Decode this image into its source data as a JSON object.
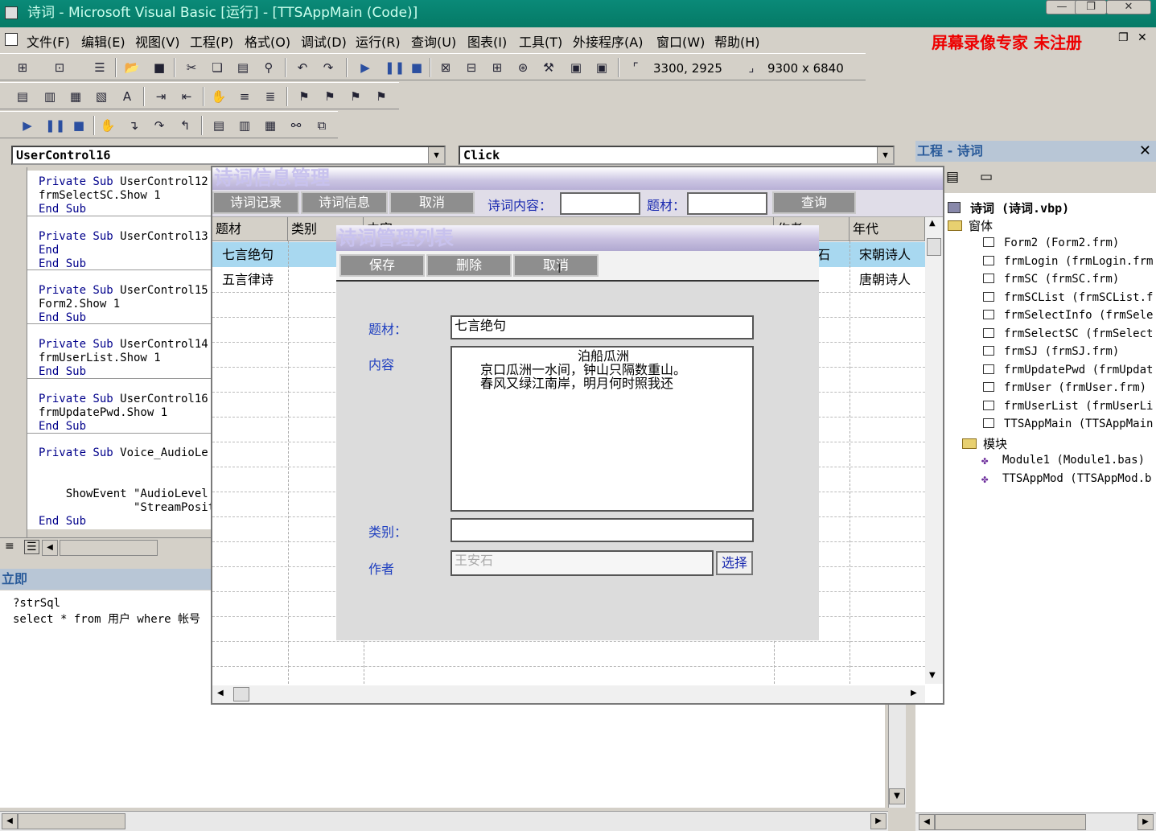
{
  "window": {
    "title": "诗词 - Microsoft Visual Basic [运行] - [TTSAppMain (Code)]",
    "minimize": "—",
    "restore": "❐",
    "close": "✕"
  },
  "menu": {
    "items": [
      "文件(F)",
      "编辑(E)",
      "视图(V)",
      "工程(P)",
      "格式(O)",
      "调试(D)",
      "运行(R)",
      "查询(U)",
      "图表(I)",
      "工具(T)",
      "外接程序(A)",
      "窗口(W)",
      "帮助(H)"
    ],
    "recorder_label": "屏幕录像专家 未注册"
  },
  "toolbar": {
    "position": "3300, 2925",
    "size": "9300 x 6840"
  },
  "code_window": {
    "object_combo": "UserControl16",
    "procedure_combo": "Click",
    "lines": [
      {
        "kw": "Private Sub",
        "rest": " UserControl12"
      },
      {
        "kw": "",
        "rest": "frmSelectSC.Show 1"
      },
      {
        "kw": "End Sub",
        "rest": ""
      },
      {
        "kw": "Private Sub",
        "rest": " UserControl13"
      },
      {
        "kw": "End",
        "rest": ""
      },
      {
        "kw": "End Sub",
        "rest": ""
      },
      {
        "kw": "Private Sub",
        "rest": " UserControl15"
      },
      {
        "kw": "",
        "rest": "Form2.Show 1"
      },
      {
        "kw": "End Sub",
        "rest": ""
      },
      {
        "kw": "Private Sub",
        "rest": " UserControl14"
      },
      {
        "kw": "",
        "rest": "frmUserList.Show 1"
      },
      {
        "kw": "End Sub",
        "rest": ""
      },
      {
        "kw": "Private Sub",
        "rest": " UserControl16"
      },
      {
        "kw": "",
        "rest": "frmUpdatePwd.Show 1"
      },
      {
        "kw": "End Sub",
        "rest": ""
      },
      {
        "kw": "Private Sub",
        "rest": " Voice_AudioLe"
      },
      {
        "kw": "",
        "rest": "    ShowEvent \"AudioLevel"
      },
      {
        "kw": "",
        "rest": "              \"StreamPositi"
      },
      {
        "kw": "End Sub",
        "rest": ""
      }
    ]
  },
  "immediate": {
    "title": "立即",
    "line1": "?strSql",
    "line2": "select * from 用户 where 帐号"
  },
  "project": {
    "title": "工程 - 诗词",
    "root": "诗词 (诗词.vbp)",
    "forms_folder": "窗体",
    "forms": [
      "Form2 (Form2.frm)",
      "frmLogin (frmLogin.frm",
      "frmSC (frmSC.frm)",
      "frmSCList (frmSCList.f",
      "frmSelectInfo (frmSele",
      "frmSelectSC (frmSelect",
      "frmSJ (frmSJ.frm)",
      "frmUpdatePwd (frmUpdat",
      "frmUser (frmUser.frm)",
      "frmUserList (frmUserLi",
      "TTSAppMain (TTSAppMain"
    ],
    "modules_folder": "模块",
    "modules": [
      "Module1 (Module1.bas)",
      "TTSAppMod (TTSAppMod.b"
    ]
  },
  "form1": {
    "title": "诗词信息管理",
    "btn_records": "诗词记录",
    "btn_info": "诗词信息",
    "btn_cancel": "取消",
    "content_label": "诗词内容：",
    "theme_label": "题材：",
    "btn_query": "查询",
    "columns": [
      "题材",
      "类别",
      "内容",
      "作者",
      "年代"
    ],
    "rows": [
      {
        "theme": "七言绝句",
        "author_frag": "石",
        "era": "宋朝诗人"
      },
      {
        "theme": "五言律诗",
        "author_frag": "",
        "era": "唐朝诗人"
      }
    ]
  },
  "form2": {
    "title": "诗词管理列表",
    "btn_save": "保存",
    "btn_delete": "删除",
    "btn_cancel": "取消",
    "theme_label": "题材：",
    "theme_value": "七言绝句",
    "content_label": "内容",
    "content_lines": [
      "泊船瓜洲",
      "京口瓜洲一水间，钟山只隔数重山。",
      "春风又绿江南岸，明月何时照我还"
    ],
    "category_label": "类别：",
    "category_value": "",
    "author_label": "作者",
    "author_value": "王安石",
    "btn_select": "选择"
  }
}
